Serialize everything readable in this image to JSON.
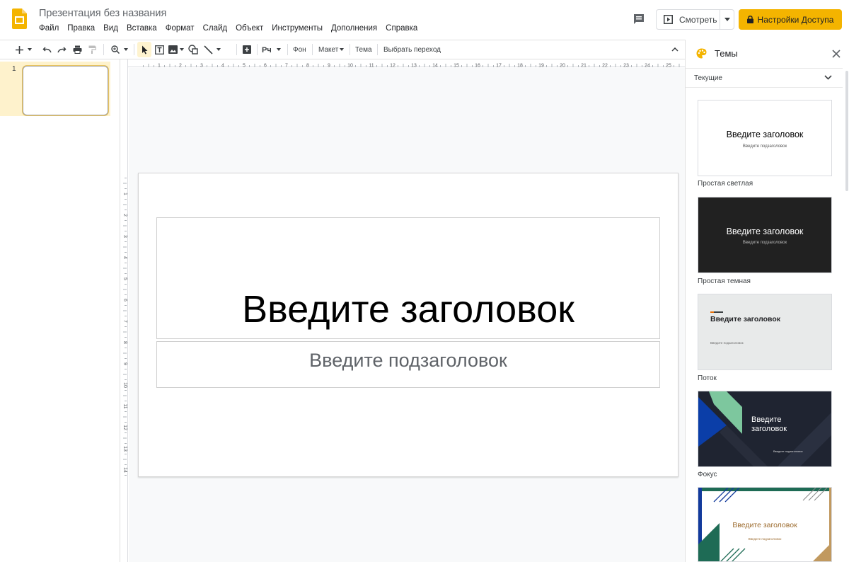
{
  "header": {
    "doc_title": "Презентация без названия",
    "menu": [
      "Файл",
      "Правка",
      "Вид",
      "Вставка",
      "Формат",
      "Слайд",
      "Объект",
      "Инструменты",
      "Дополнения",
      "Справка"
    ],
    "present_label": "Смотреть",
    "share_label": "Настройки Доступа"
  },
  "toolbar": {
    "background_label": "Фон",
    "layout_label": "Макет",
    "theme_label": "Тема",
    "transition_label": "Выбрать переход",
    "icons": [
      "plus-icon",
      "undo-icon",
      "redo-icon",
      "print-icon",
      "paint-format-icon",
      "zoom-icon",
      "cursor-icon",
      "textbox-icon",
      "image-icon",
      "shape-icon",
      "line-icon",
      "comment-add-icon",
      "spellcheck-icon"
    ]
  },
  "ruler": {
    "horizontal_ticks": [
      "1",
      "2",
      "3",
      "4",
      "5",
      "6",
      "7",
      "8",
      "9",
      "10",
      "11",
      "12",
      "13",
      "14",
      "15",
      "16",
      "17",
      "18",
      "19",
      "20",
      "21",
      "22",
      "23",
      "24",
      "25"
    ],
    "vertical_ticks": [
      "1",
      "2",
      "3",
      "4",
      "5",
      "6",
      "7",
      "8",
      "9",
      "10",
      "11",
      "12",
      "13",
      "14"
    ]
  },
  "filmstrip": {
    "slide_number": "1"
  },
  "slide": {
    "title": "Введите заголовок",
    "subtitle": "Введите подзаголовок"
  },
  "themes": {
    "panel_title": "Темы",
    "filter_label": "Текущие",
    "items": [
      {
        "name": "Простая светлая",
        "title": "Введите заголовок",
        "subtitle": "Введите подзаголовок",
        "bg": "#ffffff"
      },
      {
        "name": "Простая темная",
        "title": "Введите заголовок",
        "subtitle": "Введите подзаголовок",
        "bg": "#212121"
      },
      {
        "name": "Поток",
        "title": "Введите заголовок",
        "subtitle": "Введите подзаголовок",
        "bg": "#e8eaea"
      },
      {
        "name": "Фокус",
        "title": "Введите заголовок",
        "subtitle": "Введите подзаголовок",
        "bg": "#1f2431"
      },
      {
        "name": "",
        "title": "Введите заголовок",
        "subtitle": "Введите подзаголовок",
        "bg": "#ffffff"
      }
    ]
  },
  "colors": {
    "accent_yellow": "#f4b400",
    "selection_bg": "#fef2cc"
  }
}
